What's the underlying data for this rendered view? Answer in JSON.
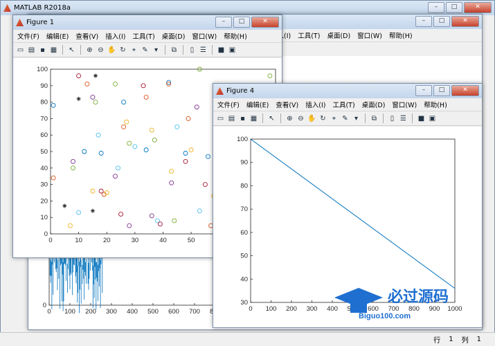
{
  "main_window": {
    "title": "MATLAB R2018a"
  },
  "figure1": {
    "title": "Figure 1"
  },
  "figure4": {
    "title": "Figure 4"
  },
  "menu": [
    "文件(F)",
    "编辑(E)",
    "查看(V)",
    "插入(I)",
    "工具(T)",
    "桌面(D)",
    "窗口(W)",
    "帮助(H)"
  ],
  "statusbar": {
    "row_label": "行",
    "row_value": "1",
    "col_label": "列",
    "col_value": "1"
  },
  "watermark": {
    "text": "必过源码",
    "sub": "Biguo100.com"
  },
  "colors": {
    "accent": "#0072bd",
    "titlebar": "#c4d6ec",
    "close": "#c7412b"
  },
  "chart_data": [
    {
      "type": "scatter",
      "xlim": [
        0,
        80
      ],
      "ylim": [
        0,
        100
      ],
      "xticks": [
        "0",
        "10",
        "20",
        "30",
        "40",
        "50",
        "60",
        "70",
        "80"
      ],
      "yticks": [
        "0",
        "10",
        "20",
        "30",
        "40",
        "50",
        "60",
        "70",
        "80",
        "90",
        "100"
      ],
      "series": [
        {
          "marker": "circle",
          "points": [
            [
              1,
              78
            ],
            [
              1,
              34
            ],
            [
              7,
              5
            ],
            [
              8,
              44
            ],
            [
              8,
              40
            ],
            [
              10,
              13
            ],
            [
              10,
              96
            ],
            [
              12,
              50
            ],
            [
              13,
              91
            ],
            [
              15,
              26
            ],
            [
              15,
              83
            ],
            [
              16,
              80
            ],
            [
              17,
              60
            ],
            [
              18,
              26
            ],
            [
              18,
              49
            ],
            [
              19,
              24
            ],
            [
              20,
              25
            ],
            [
              23,
              35
            ],
            [
              23,
              91
            ],
            [
              24,
              40
            ],
            [
              25,
              12
            ],
            [
              26,
              80
            ],
            [
              26,
              65
            ],
            [
              27,
              68
            ],
            [
              28,
              5
            ],
            [
              28,
              55
            ],
            [
              30,
              53
            ],
            [
              33,
              90
            ],
            [
              34,
              51
            ],
            [
              34,
              83
            ],
            [
              36,
              63
            ],
            [
              36,
              11
            ],
            [
              37,
              57
            ],
            [
              38,
              8
            ],
            [
              39,
              6
            ],
            [
              42,
              92
            ],
            [
              42,
              91
            ],
            [
              43,
              38
            ],
            [
              43,
              31
            ],
            [
              44,
              8
            ],
            [
              45,
              65
            ],
            [
              48,
              44
            ],
            [
              48,
              49
            ],
            [
              49,
              70
            ],
            [
              50,
              51
            ],
            [
              52,
              77
            ],
            [
              53,
              100
            ],
            [
              53,
              14
            ],
            [
              55,
              30
            ],
            [
              56,
              47
            ],
            [
              57,
              5
            ],
            [
              58,
              23
            ],
            [
              59,
              55
            ],
            [
              60,
              36
            ],
            [
              61,
              45
            ],
            [
              62,
              48
            ],
            [
              63,
              42
            ],
            [
              64,
              73
            ],
            [
              65,
              4
            ],
            [
              65,
              16
            ],
            [
              66,
              77
            ],
            [
              67,
              75
            ],
            [
              68,
              30
            ],
            [
              68,
              7
            ],
            [
              69,
              76
            ],
            [
              70,
              14
            ],
            [
              71,
              3
            ],
            [
              72,
              85
            ],
            [
              73,
              24
            ],
            [
              74,
              19
            ],
            [
              74,
              26
            ],
            [
              75,
              39
            ],
            [
              76,
              80
            ],
            [
              77,
              39
            ],
            [
              78,
              96
            ],
            [
              80,
              14
            ]
          ]
        },
        {
          "marker": "asterisk",
          "points": [
            [
              5,
              17
            ],
            [
              10,
              82
            ],
            [
              16,
              96
            ],
            [
              15,
              14
            ],
            [
              78,
              8
            ]
          ]
        }
      ]
    },
    {
      "type": "line",
      "xlim": [
        0,
        1000
      ],
      "ylim": [
        30,
        100
      ],
      "xticks": [
        "0",
        "100",
        "200",
        "300",
        "400",
        "500",
        "600",
        "700",
        "800",
        "900",
        "1000"
      ],
      "yticks": [
        "30",
        "40",
        "50",
        "60",
        "70",
        "80",
        "90",
        "100"
      ],
      "x": [
        0,
        1000
      ],
      "y": [
        100,
        36
      ]
    },
    {
      "type": "bar",
      "xlim": [
        0,
        800
      ],
      "ylim": [
        0,
        8
      ],
      "xticks": [
        "0",
        "100",
        "200",
        "300",
        "400",
        "500",
        "600",
        "700",
        "800"
      ],
      "yticks": [
        "0",
        "5"
      ],
      "note_values_random": true
    }
  ]
}
